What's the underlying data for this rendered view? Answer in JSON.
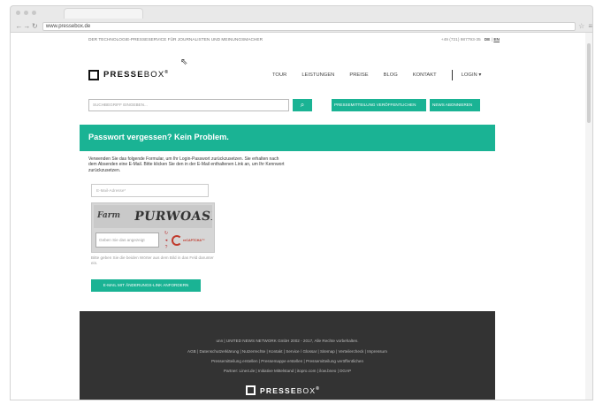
{
  "browser": {
    "url": "www.pressebox.de"
  },
  "topbar": {
    "tagline": "DER TECHNOLOGIE-PRESSESERVICE FÜR JOURNALISTEN UND MEINUNGSMACHER",
    "phone": "+49 (721) 987793-35",
    "lang_de": "DE",
    "lang_sep": "|",
    "lang_en": "EN"
  },
  "logo": {
    "bold": "PRESSE",
    "thin": "BOX",
    "mark": "®"
  },
  "nav": {
    "items": [
      "TOUR",
      "LEISTUNGEN",
      "PREISE",
      "BLOG",
      "KONTAKT"
    ],
    "login": "LOGIN ▾"
  },
  "search": {
    "placeholder": "SUCHBEGRIFF EINGEBEN...",
    "btn_pm": "PRESSEMITTEILUNG VERÖFFENTLICHEN",
    "btn_nl": "NEWS ABONNIEREN"
  },
  "banner": {
    "title": "Passwort vergessen? Kein Problem."
  },
  "form": {
    "intro": "Verwenden Sie das folgende Formular, um Ihr Login-Passwort zurückzusetzen. Sie erhalten nach dem Absenden eine E-Mail. Bitte klicken Sie den in der E-Mail enthaltenen Link an, um Ihr Kennwort zurückzusetzen.",
    "email_placeholder": "E-Mail-Adresse*",
    "captcha_word1": "Farm",
    "captcha_word2": "PURWOASRI",
    "captcha_placeholder": "Geben Sie das angezeigt",
    "captcha_logo": "reCAPTCHA™",
    "captcha_help": "Bitte geben Sie die beiden Wörter aus dem Bild in das Feld darunter ein.",
    "submit": "E-MAIL MIT ÄNDERUNGS-LINK ANFORDERN"
  },
  "footer": {
    "copyright": "unn | UNITED NEWS NETWORK GmbH 2002 - 2017, Alle Rechte vorbehalten.",
    "links1": "AGB | Datenschutzerklärung | Nutzerrechte | Kontakt | Service / Glossar | Sitemap | Verteilercheck | Impressum",
    "links2": "Pressemitteilung erstellen | Pressemappe erstellen | Pressemitteilung veröffentlichen",
    "partner": "Partner: Line4.de | Initiative Mittelstand | itopro.com | ilow.bneo | DGAP",
    "logo_bold": "PRESSE",
    "logo_thin": "BOX",
    "logo_mark": "®"
  },
  "colors": {
    "accent": "#1ab394",
    "footer_bg": "#333333"
  }
}
